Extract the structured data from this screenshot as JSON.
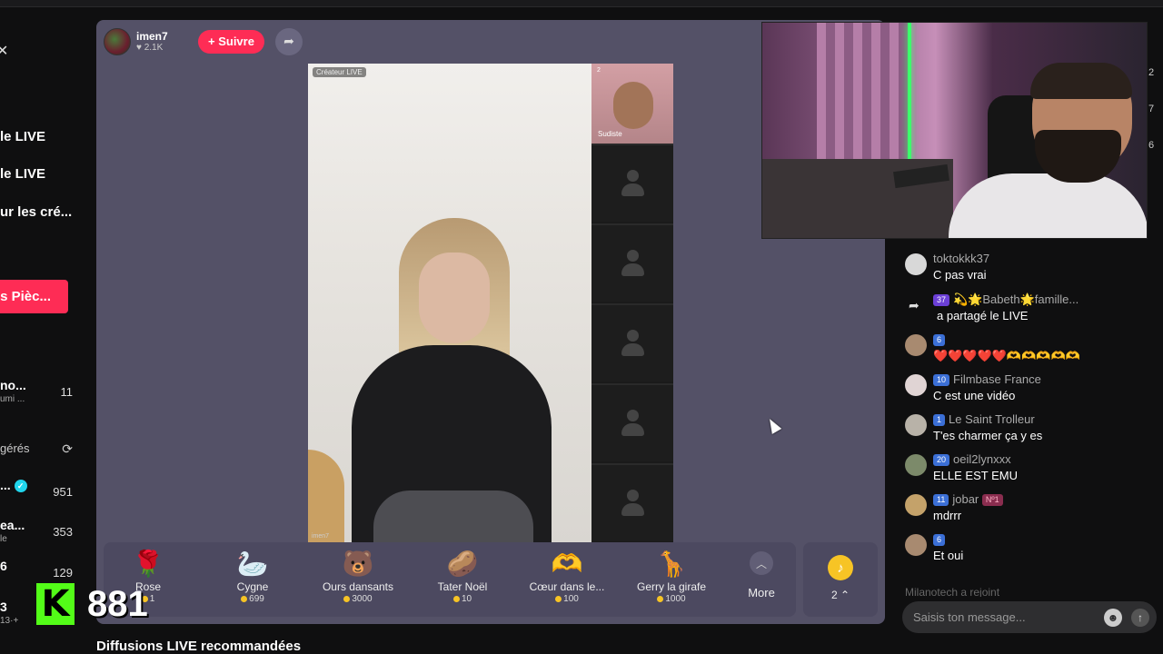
{
  "sidebar": {
    "links": [
      "le LIVE",
      "le LIVE",
      "ur les cré..."
    ],
    "coins_button": "es Pièc...",
    "followed": [
      {
        "name": "no...",
        "sub": "umi ...",
        "count": "11"
      }
    ],
    "suggested_label": "gérés",
    "suggested": [
      {
        "name": "...",
        "count": "951",
        "verified": true
      },
      {
        "name": "ea...",
        "sub": "le",
        "count": "353"
      },
      {
        "name": "6",
        "count": "129"
      },
      {
        "name": "3",
        "sub": "13·+",
        "count": ""
      }
    ]
  },
  "host": {
    "name": "imen7",
    "likes": "2.1K",
    "follow_label": "+ Suivre"
  },
  "stage": {
    "creator_tag": "Créateur LIVE",
    "main_name": "imen7",
    "guest_name": "Sudiste",
    "guest_count": "2"
  },
  "gifts": [
    {
      "name": "Rose",
      "price": "1",
      "icon": "rose-icon",
      "glyph": "🌹"
    },
    {
      "name": "Cygne",
      "price": "699",
      "icon": "swan-icon",
      "glyph": "🦢"
    },
    {
      "name": "Ours dansants",
      "price": "3000",
      "icon": "bear-icon",
      "glyph": "🐻"
    },
    {
      "name": "Tater Noël",
      "price": "10",
      "icon": "potato-icon",
      "glyph": "🥔"
    },
    {
      "name": "Cœur dans le...",
      "price": "100",
      "icon": "heart-hands-icon",
      "glyph": "🫶"
    },
    {
      "name": "Gerry la girafe",
      "price": "1000",
      "icon": "giraffe-icon",
      "glyph": "🦒"
    }
  ],
  "more_label": "More",
  "balance": "2",
  "recommended_title": "Diffusions LIVE recommandées",
  "kick": {
    "letter": "K",
    "count": "881"
  },
  "edge_numbers": [
    "2",
    "7",
    "6"
  ],
  "chat": {
    "messages": [
      {
        "user": "toktokkk37",
        "text": "C pas vrai",
        "badges": []
      },
      {
        "user": "💫🌟Babeth🌟famille...",
        "text": "a partagé le LIVE",
        "badges": [
          "37"
        ],
        "share": true
      },
      {
        "user": "",
        "text": "❤️❤️❤️❤️❤️🫶🫶🫶🫶🫶",
        "badges": [
          "6"
        ]
      },
      {
        "user": "Filmbase France",
        "text": "C est une vidéo",
        "badges": [
          "10"
        ]
      },
      {
        "user": "Le Saint Trolleur",
        "text": "T'es charmer ça y es",
        "badges": [
          "1"
        ]
      },
      {
        "user": "oeil2lynxxx",
        "text": "ELLE EST EMU",
        "badges": [
          "20"
        ]
      },
      {
        "user": "jobar",
        "text": "mdrrr",
        "badges": [
          "11",
          "Nº1"
        ]
      },
      {
        "user": "",
        "text": "Et oui",
        "badges": [
          "6"
        ]
      }
    ],
    "joined": "Milanotech a rejoint",
    "input_placeholder": "Saisis ton message..."
  }
}
